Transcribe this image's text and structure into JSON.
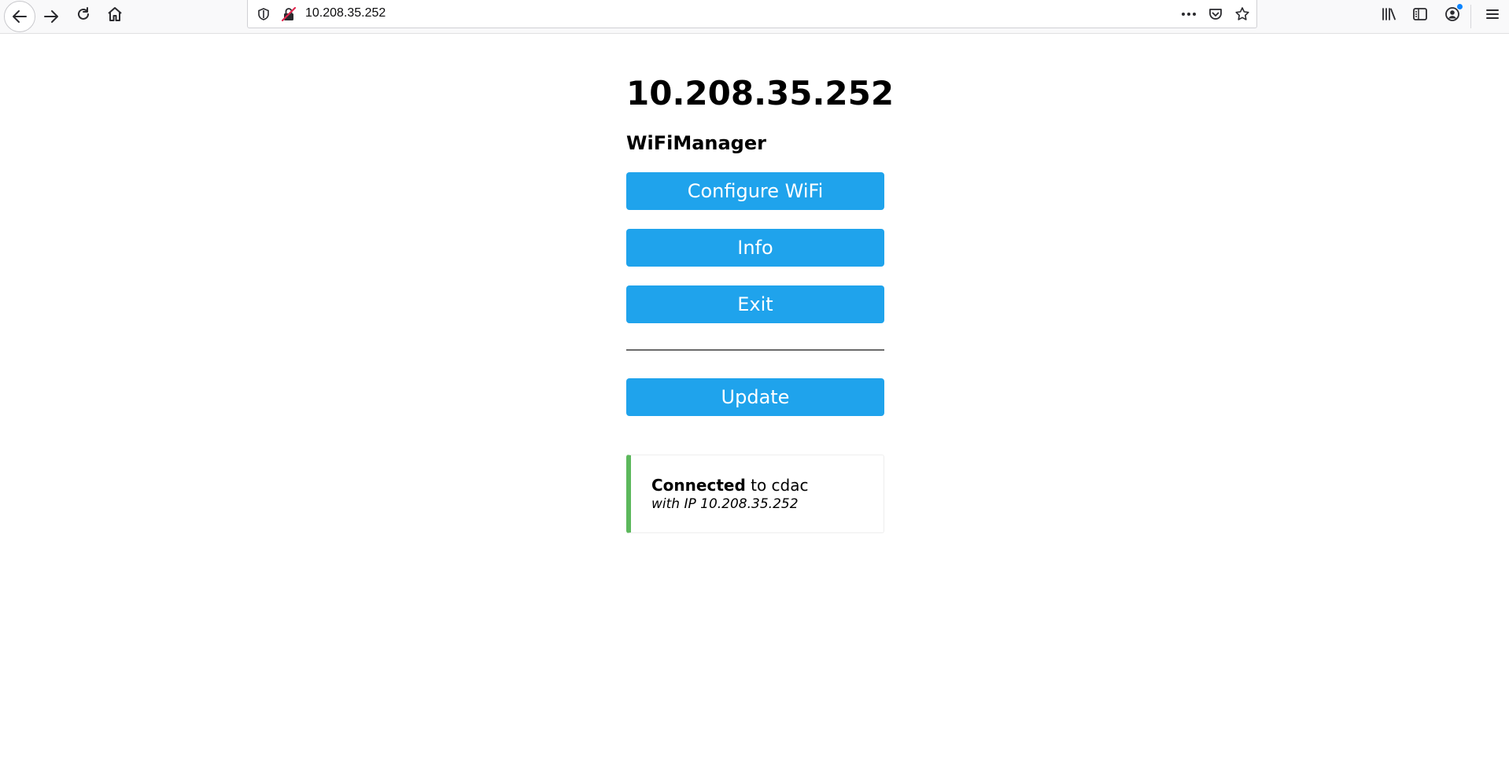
{
  "browser": {
    "url": "10.208.35.252",
    "icons": {
      "back": "back-arrow-icon",
      "forward": "forward-arrow-icon",
      "reload": "reload-icon",
      "home": "home-icon",
      "tracking": "shield-icon",
      "insecure": "insecure-lock-icon",
      "page_actions": "more-dots-icon",
      "pocket": "pocket-icon",
      "bookmark": "star-icon",
      "library": "library-icon",
      "sidebar": "sidebar-icon",
      "account": "account-icon",
      "menu": "hamburger-menu-icon"
    }
  },
  "page": {
    "title": "10.208.35.252",
    "subtitle": "WiFiManager",
    "buttons": {
      "configure": "Configure WiFi",
      "info": "Info",
      "exit": "Exit",
      "update": "Update"
    },
    "status": {
      "connected_label": "Connected",
      "connected_rest": " to cdac",
      "ip_line": "with IP 10.208.35.252"
    }
  },
  "colors": {
    "button": "#1fa3ec",
    "status_border": "#5cb85c",
    "account_badge": "#0a84ff"
  }
}
